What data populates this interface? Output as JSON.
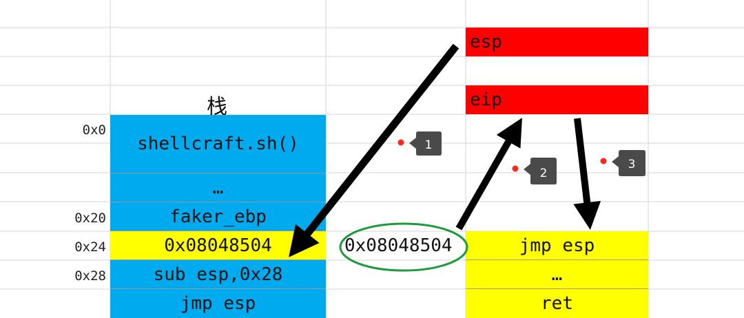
{
  "stack": {
    "title": "栈",
    "addresses": {
      "a0": "0x0",
      "a20": "0x20",
      "a24": "0x24",
      "a28": "0x28"
    },
    "cells": [
      "shellcraft.sh()",
      "…",
      "faker_ebp",
      "0x08048504",
      "sub esp,0x28",
      "jmp esp"
    ]
  },
  "middle": {
    "value": "0x08048504"
  },
  "right": {
    "registers": [
      "esp",
      "eip"
    ],
    "cells": [
      "jmp esp",
      "…",
      "ret"
    ]
  },
  "markers": [
    "1",
    "2",
    "3"
  ],
  "colors": {
    "stack_blue": "#00aaee",
    "highlight_yellow": "#ffff00",
    "register_red": "#ff0000",
    "ellipse_green": "#1a9a3a",
    "marker_red": "#ff2a1a"
  }
}
